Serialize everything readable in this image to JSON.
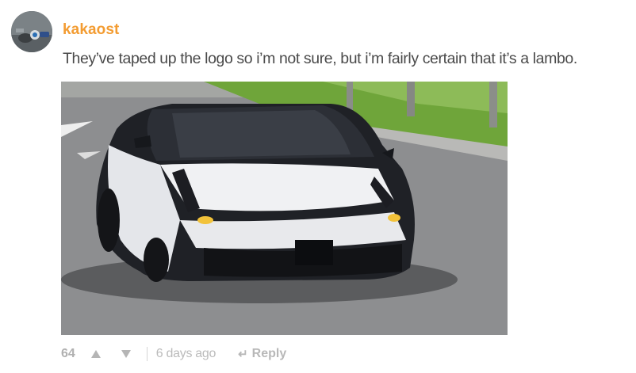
{
  "comment": {
    "username": "kakaost",
    "avatar_icon": "user-avatar-icon",
    "text": "They’ve taped up the logo so i’m not sure, but i’m fairly certain that it’s a lambo.",
    "image_subject": "camouflaged-sports-car",
    "votes": "64",
    "upvote_icon": "upvote-arrow-icon",
    "downvote_icon": "downvote-arrow-icon",
    "timestamp": "6 days ago",
    "reply_label": "Reply",
    "reply_icon": "reply-arrow-icon"
  },
  "colors": {
    "username": "#f39c32",
    "body_text": "#4a4a4a",
    "meta_text": "#b7b7b7"
  }
}
